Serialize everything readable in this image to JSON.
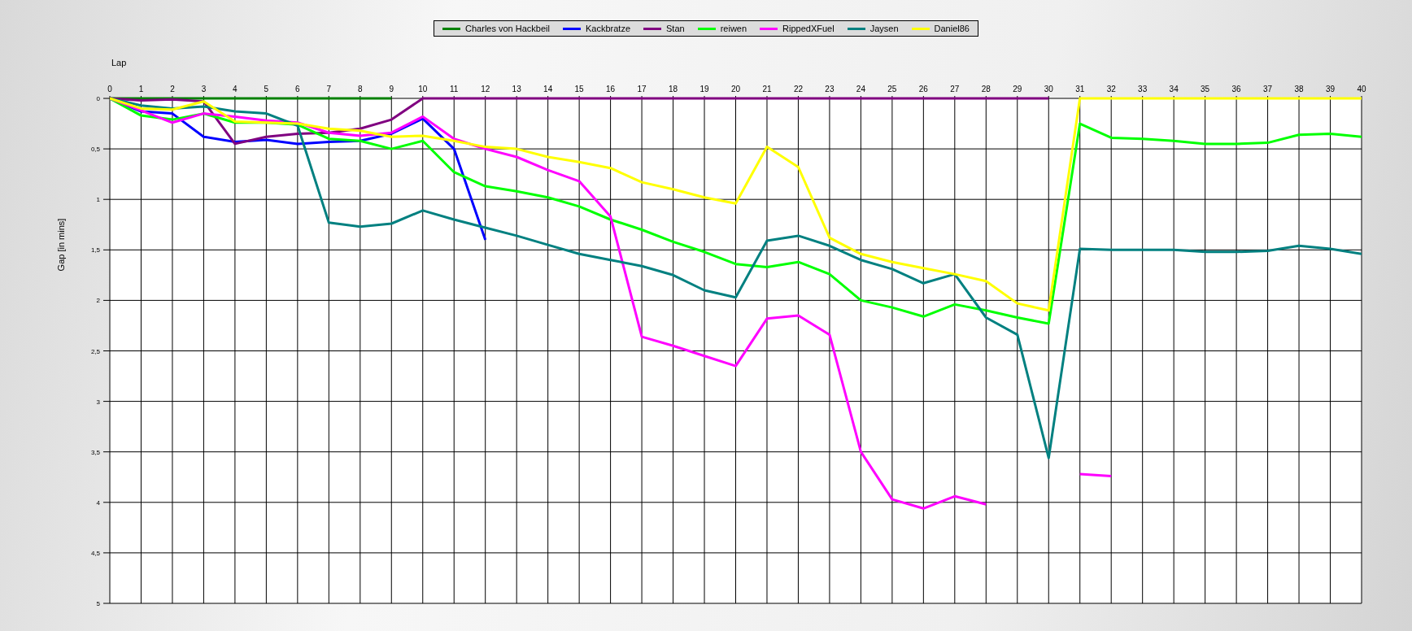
{
  "chart_data": {
    "type": "line",
    "grid": true,
    "legend": "top",
    "xlabel": "Lap",
    "ylabel": "Gap [in mins]",
    "x": [
      0,
      1,
      2,
      3,
      4,
      5,
      6,
      7,
      8,
      9,
      10,
      11,
      12,
      13,
      14,
      15,
      16,
      17,
      18,
      19,
      20,
      21,
      22,
      23,
      24,
      25,
      26,
      27,
      28,
      29,
      30,
      31,
      32,
      33,
      34,
      35,
      36,
      37,
      38,
      39,
      40
    ],
    "xlim": [
      0,
      40
    ],
    "ylim": [
      5,
      0
    ],
    "xticks": [
      0,
      1,
      2,
      3,
      4,
      5,
      6,
      7,
      8,
      9,
      10,
      11,
      12,
      13,
      14,
      15,
      16,
      17,
      18,
      19,
      20,
      21,
      22,
      23,
      24,
      25,
      26,
      27,
      28,
      29,
      30,
      31,
      32,
      33,
      34,
      35,
      36,
      37,
      38,
      39,
      40
    ],
    "yticks": [
      0,
      {
        "value": 0.5,
        "label": "0,5"
      },
      1,
      {
        "value": 1.5,
        "label": "1,5"
      },
      2,
      {
        "value": 2.5,
        "label": "2,5"
      },
      3,
      {
        "value": 3.5,
        "label": "3,5"
      },
      4,
      {
        "value": 4.5,
        "label": "4,5"
      },
      5
    ],
    "series": [
      {
        "name": "Charles von Hackbeil",
        "color": "#008000",
        "values": [
          0,
          0,
          0,
          0,
          0,
          0,
          0,
          0,
          0,
          0,
          null,
          null,
          null,
          null,
          null,
          null,
          null,
          null,
          null,
          null,
          null,
          null,
          null,
          null,
          null,
          null,
          null,
          null,
          null,
          null,
          null,
          null,
          null,
          null,
          null,
          null,
          null,
          null,
          null,
          null,
          null
        ]
      },
      {
        "name": "Kackbratze",
        "color": "#0000ff",
        "values": [
          0,
          0.13,
          0.15,
          0.38,
          0.43,
          0.41,
          0.45,
          0.43,
          0.42,
          0.35,
          0.2,
          0.5,
          1.4,
          null,
          null,
          null,
          null,
          null,
          null,
          null,
          null,
          null,
          null,
          null,
          null,
          null,
          null,
          null,
          null,
          null,
          null,
          null,
          null,
          null,
          null,
          null,
          null,
          null,
          null,
          null,
          null
        ]
      },
      {
        "name": "Stan",
        "color": "#800080",
        "values": [
          0,
          0.02,
          0.01,
          0.03,
          0.45,
          0.38,
          0.35,
          0.34,
          0.3,
          0.21,
          0,
          0,
          0,
          0,
          0,
          0,
          0,
          0,
          0,
          0,
          0,
          0,
          0,
          0,
          0,
          0,
          0,
          0,
          0,
          0,
          0,
          null,
          null,
          null,
          null,
          null,
          null,
          null,
          null,
          null,
          null
        ]
      },
      {
        "name": "reiwen",
        "color": "#00ff00",
        "values": [
          0,
          0.17,
          0.21,
          0.15,
          0.24,
          0.24,
          0.26,
          0.4,
          0.42,
          0.5,
          0.42,
          0.73,
          0.87,
          0.92,
          0.98,
          1.07,
          1.2,
          1.3,
          1.42,
          1.52,
          1.64,
          1.67,
          1.62,
          1.74,
          2.0,
          2.07,
          2.16,
          2.04,
          2.1,
          2.17,
          2.23,
          0.25,
          0.39,
          0.4,
          0.42,
          0.45,
          0.45,
          0.44,
          0.36,
          0.35,
          0.38
        ]
      },
      {
        "name": "RippedXFuel",
        "color": "#ff00ff",
        "values": [
          0,
          0.12,
          0.24,
          0.15,
          0.18,
          0.22,
          0.24,
          0.34,
          0.37,
          0.34,
          0.18,
          0.4,
          0.5,
          0.58,
          0.71,
          0.82,
          1.17,
          2.36,
          2.45,
          2.55,
          2.65,
          2.18,
          2.15,
          2.34,
          3.5,
          3.97,
          4.06,
          3.94,
          4.02,
          null,
          null,
          3.72,
          3.74,
          null,
          null,
          null,
          null,
          null,
          null,
          null,
          null
        ]
      },
      {
        "name": "Jaysen",
        "color": "#008080",
        "values": [
          0,
          0.07,
          0.1,
          0.08,
          0.13,
          0.15,
          0.27,
          1.23,
          1.27,
          1.24,
          1.11,
          1.2,
          1.28,
          1.36,
          1.45,
          1.54,
          1.6,
          1.66,
          1.75,
          1.9,
          1.97,
          1.41,
          1.36,
          1.46,
          1.6,
          1.69,
          1.83,
          1.74,
          2.17,
          2.34,
          3.56,
          1.49,
          1.5,
          1.5,
          1.5,
          1.52,
          1.52,
          1.51,
          1.46,
          1.49,
          1.54
        ]
      },
      {
        "name": "Daniel86",
        "color": "#ffff00",
        "values": [
          0,
          0.1,
          0.11,
          0.03,
          0.23,
          0.24,
          0.25,
          0.3,
          0.32,
          0.38,
          0.37,
          0.42,
          0.48,
          0.5,
          0.58,
          0.63,
          0.69,
          0.83,
          0.9,
          0.98,
          1.04,
          0.48,
          0.68,
          1.38,
          1.54,
          1.62,
          1.68,
          1.74,
          1.81,
          2.03,
          2.1,
          0,
          0,
          0,
          0,
          0,
          0,
          0,
          0,
          0,
          0
        ]
      }
    ]
  }
}
